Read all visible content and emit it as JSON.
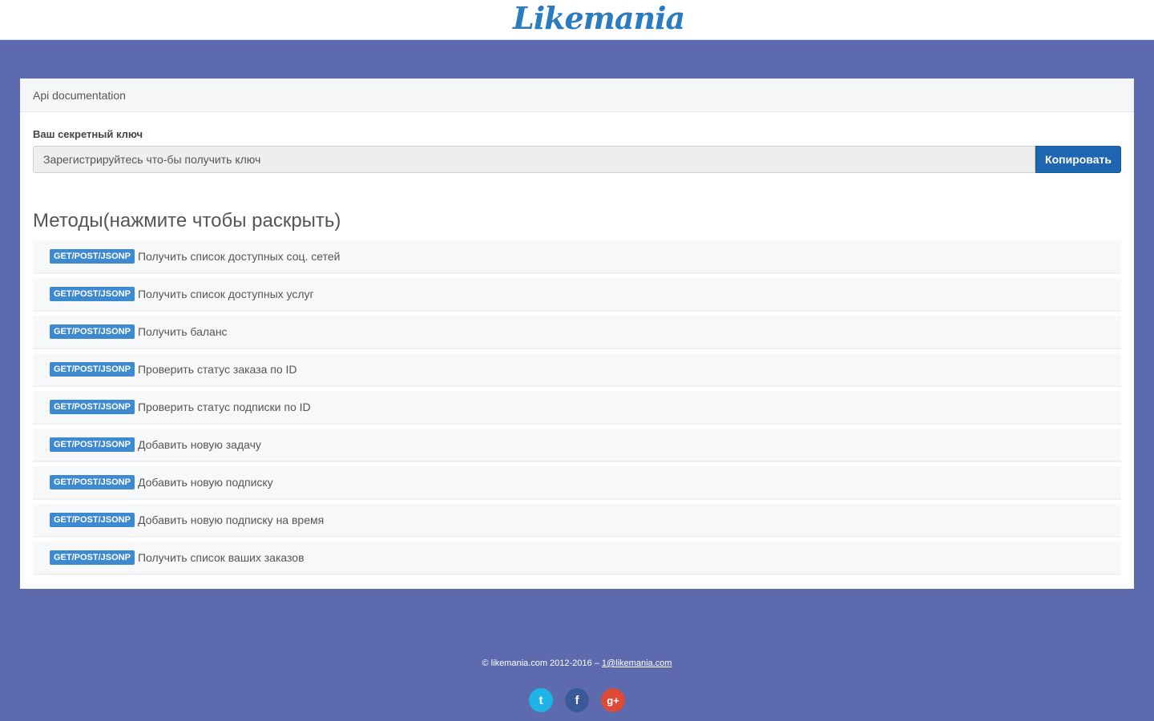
{
  "header": {
    "logo_text": "Likemania"
  },
  "panel": {
    "title": "Api documentation",
    "key_label": "Ваш секретный ключ",
    "key_value": "Зарегистрируйтесь что-бы получить ключ",
    "copy_button": "Копировать"
  },
  "methods": {
    "title": "Методы(нажмите чтобы раскрыть)",
    "items": [
      {
        "badge": "GET/POST/JSONP",
        "label": "Получить список доступных соц. сетей"
      },
      {
        "badge": "GET/POST/JSONP",
        "label": "Получить список доступных услуг"
      },
      {
        "badge": "GET/POST/JSONP",
        "label": "Получить баланс"
      },
      {
        "badge": "GET/POST/JSONP",
        "label": "Проверить статус заказа по ID"
      },
      {
        "badge": "GET/POST/JSONP",
        "label": "Проверить статус подписки по ID"
      },
      {
        "badge": "GET/POST/JSONP",
        "label": "Добавить новую задачу"
      },
      {
        "badge": "GET/POST/JSONP",
        "label": "Добавить новую подписку"
      },
      {
        "badge": "GET/POST/JSONP",
        "label": "Добавить новую подписку на время"
      },
      {
        "badge": "GET/POST/JSONP",
        "label": "Получить список ваших заказов"
      }
    ]
  },
  "footer": {
    "copyright": "© likemania.com 2012-2016 – ",
    "email": "1@likemania.com",
    "socials": [
      {
        "icon": "twitter-icon",
        "glyph": "t",
        "color": "#1fb4e8"
      },
      {
        "icon": "facebook-icon",
        "glyph": "f",
        "color": "#3b5998"
      },
      {
        "icon": "google-plus-icon",
        "glyph": "g+",
        "color": "#dc4a38"
      }
    ]
  },
  "colors": {
    "background": "#5d6aae",
    "accent": "#1f66b0",
    "badge": "#3d8ad1"
  }
}
